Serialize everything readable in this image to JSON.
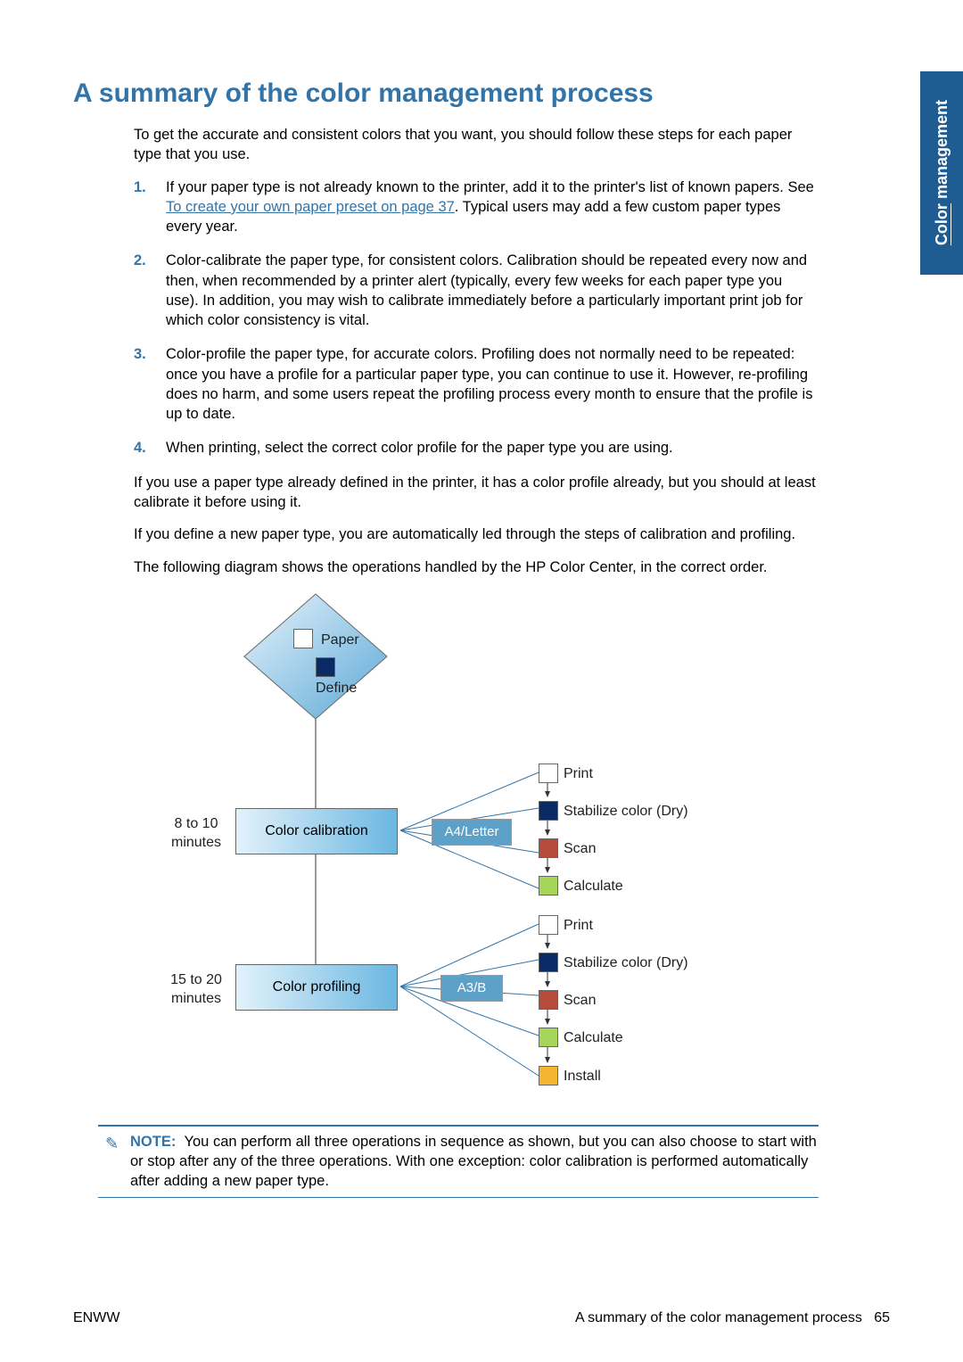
{
  "sideTab": {
    "top": "Color",
    "bottom": "management"
  },
  "heading": "A summary of the color management process",
  "intro": "To get the accurate and consistent colors that you want, you should follow these steps for each paper type that you use.",
  "steps": [
    {
      "n": "1.",
      "before": "If your paper type is not already known to the printer, add it to the printer's list of known papers. See ",
      "link": "To create your own paper preset on page 37",
      "after": ". Typical users may add a few custom paper types every year."
    },
    {
      "n": "2.",
      "text": "Color-calibrate the paper type, for consistent colors. Calibration should be repeated every now and then, when recommended by a printer alert (typically, every few weeks for each paper type you use). In addition, you may wish to calibrate immediately before a particularly important print job for which color consistency is vital."
    },
    {
      "n": "3.",
      "text": "Color-profile the paper type, for accurate colors. Profiling does not normally need to be repeated: once you have a profile for a particular paper type, you can continue to use it. However, re-profiling does no harm, and some users repeat the profiling process every month to ensure that the profile is up to date."
    },
    {
      "n": "4.",
      "text": "When printing, select the correct color profile for the paper type you are using."
    }
  ],
  "para1": "If you use a paper type already defined in the printer, it has a color profile already, but you should at least calibrate it before using it.",
  "para2": "If you define a new paper type, you are automatically led through the steps of calibration and profiling.",
  "para3": "The following diagram shows the operations handled by the HP Color Center, in the correct order.",
  "diagram": {
    "decision": {
      "l1": "Paper",
      "l2": "Define"
    },
    "calib": {
      "duration1": "8 to 10",
      "duration2": "minutes",
      "box": "Color calibration",
      "page": "A4/Letter",
      "steps": [
        "Print",
        "Stabilize color (Dry)",
        "Scan",
        "Calculate"
      ]
    },
    "prof": {
      "duration1": "15 to 20",
      "duration2": "minutes",
      "box": "Color profiling",
      "page": "A3/B",
      "steps": [
        "Print",
        "Stabilize color (Dry)",
        "Scan",
        "Calculate",
        "Install"
      ]
    }
  },
  "note": {
    "label": "NOTE:",
    "text": "You can perform all three operations in sequence as shown, but you can also choose to start with or stop after any of the three operations. With one exception: color calibration is performed automatically after adding a new paper type."
  },
  "footer": {
    "left": "ENWW",
    "rightText": "A summary of the color management process",
    "page": "65"
  }
}
